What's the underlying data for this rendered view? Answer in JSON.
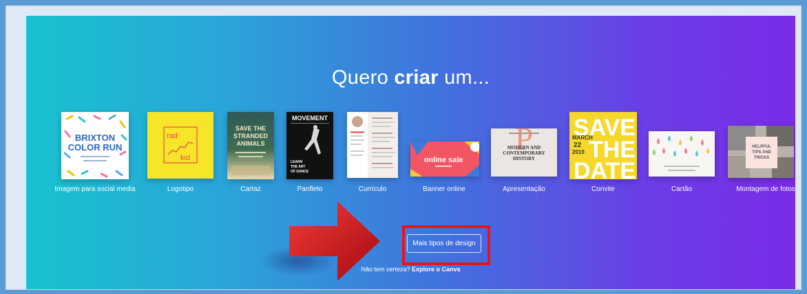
{
  "headline": {
    "prefix": "Quero ",
    "bold": "criar",
    "suffix": " um..."
  },
  "design_types": [
    {
      "label": "Imagem para social media",
      "thumb_text": [
        "BRIXTON",
        "COLOR RUN"
      ]
    },
    {
      "label": "Logotipo",
      "thumb_text": [
        "rad",
        "kid"
      ]
    },
    {
      "label": "Cartaz",
      "thumb_text": [
        "SAVE THE",
        "STRANDED",
        "ANIMALS"
      ]
    },
    {
      "label": "Panfleto",
      "thumb_text": [
        "MOVEMENT",
        "LEARN",
        "THE ART",
        "OF DANCE"
      ]
    },
    {
      "label": "Currículo",
      "thumb_text": []
    },
    {
      "label": "Banner online",
      "thumb_text": [
        "online sale"
      ]
    },
    {
      "label": "Apresentação",
      "thumb_text": [
        "MODERN AND",
        "CONTEMPORARY",
        "HISTORY"
      ]
    },
    {
      "label": "Convite",
      "thumb_text": [
        "SAVE",
        "THE",
        "DATE",
        "MARCH",
        "22",
        "2019"
      ]
    },
    {
      "label": "Cartão",
      "thumb_text": []
    },
    {
      "label": "Montagem de fotos",
      "thumb_text": [
        "HELPFUL",
        "TIPS AND",
        "TRICKS"
      ]
    }
  ],
  "more_button": {
    "label": "Mais tipos de design"
  },
  "hint": {
    "text": "Não tem certeza? ",
    "link": "Explore o Canva"
  },
  "colors": {
    "highlight": "#e8141c",
    "arrow": "#d0121a"
  }
}
